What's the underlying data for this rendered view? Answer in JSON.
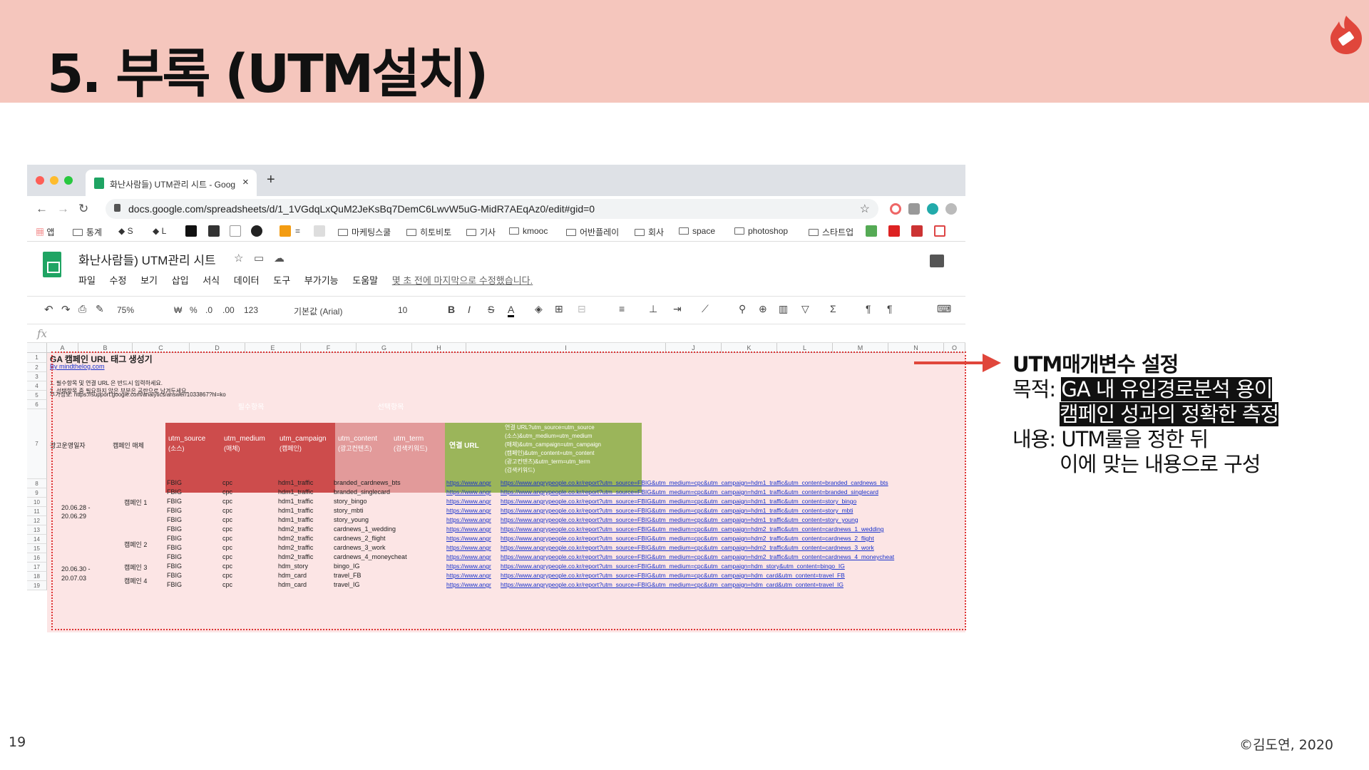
{
  "slide": {
    "title": "5. 부록 (UTM설치)",
    "page_number": "19",
    "copyright": "©김도연, 2020"
  },
  "browser": {
    "tab_title": "화난사람들) UTM관리 시트 - Goog",
    "tab_close": "×",
    "new_tab": "+",
    "url": "docs.google.com/spreadsheets/d/1_1VGdqLxQuM2JeKsBq7DemC6LwvW5uG-MidR7AEqAz0/edit#gid=0",
    "bookmarks": [
      "앱",
      "통계",
      "S",
      "L",
      "=",
      "마케팅스쿨",
      "히토비토",
      "기사",
      "kmooc",
      "어반플레이",
      "회사",
      "space",
      "photoshop",
      "스타트업"
    ]
  },
  "doc": {
    "title": "화난사람들) UTM관리 시트",
    "menus": [
      "파일",
      "수정",
      "보기",
      "삽입",
      "서식",
      "데이터",
      "도구",
      "부가기능",
      "도움말"
    ],
    "last_edit": "몇 초 전에 마지막으로 수정했습니다.",
    "toolbar": {
      "zoom": "75%",
      "currency": "₩",
      "percent": "%",
      "dec_less": ".0",
      "dec_more": ".00",
      "format": "123",
      "font": "기본값 (Arial)",
      "size": "10",
      "bold": "B",
      "italic": "I",
      "strike": "S",
      "color": "A"
    },
    "fx": "fx"
  },
  "sheet": {
    "columns": [
      "A",
      "B",
      "C",
      "D",
      "E",
      "F",
      "G",
      "H",
      "I",
      "J",
      "K",
      "L",
      "M",
      "N",
      "O"
    ],
    "rows": [
      "1",
      "2",
      "3",
      "4",
      "5",
      "6",
      "7",
      "8",
      "9",
      "10",
      "11",
      "12",
      "13",
      "14",
      "15",
      "16",
      "17",
      "18",
      "19"
    ],
    "title": "GA 캠페인 URL 태그 생성기",
    "by": "By mindthelog.com",
    "note1": "1. 필수항목 및 연결 URL 은 반드시 입력하세요.",
    "note2": "2. 선택항목 중 필요하지 않은 부분은 공란으로 남겨두세요.",
    "note3": "추가정보: https://support.google.com/analytics/answer/1033867?hl=ko",
    "group_required": "필수항목",
    "group_optional": "선택항목",
    "h_date": "광고운영일자",
    "h_campaign": "캠페인 매체",
    "h_source": "utm_source",
    "h_source_sub": "(소스)",
    "h_medium": "utm_medium",
    "h_medium_sub": "(매체)",
    "h_campaign_utm": "utm_campaign",
    "h_campaign_sub": "(캠페인)",
    "h_content": "utm_content",
    "h_content_sub": "(광고컨텐츠)",
    "h_term": "utm_term",
    "h_term_sub": "(검색키워드)",
    "h_url": "연결 URL",
    "h_full": [
      "연결 URL?utm_source=utm_source",
      "(소스)&utm_medium=utm_medium",
      "(매체)&utm_campaign=utm_campaign",
      "(캠페인)&utm_content=utm_content",
      "(광고컨텐츠)&utm_term=utm_term",
      "(검색키워드)"
    ],
    "date1": "20.06.28 -",
    "date1b": "20.06.29",
    "date2": "20.06.30 -",
    "date2b": "20.07.03",
    "camp1": "캠페인 1",
    "camp2": "캠페인 2",
    "camp3": "캠페인 3",
    "camp4": "캠페인 4",
    "data": [
      {
        "src": "FBIG",
        "med": "cpc",
        "camp": "hdm1_traffic",
        "content": "branded_cardnews_bts",
        "url": "https://www.angr",
        "full": "https://www.angrypeople.co.kr/report?utm_source=FBIG&utm_medium=cpc&utm_campaign=hdm1_traffic&utm_content=branded_cardnews_bts"
      },
      {
        "src": "FBIG",
        "med": "cpc",
        "camp": "hdm1_traffic",
        "content": "branded_singlecard",
        "url": "https://www.angr",
        "full": "https://www.angrypeople.co.kr/report?utm_source=FBIG&utm_medium=cpc&utm_campaign=hdm1_traffic&utm_content=branded_singlecard"
      },
      {
        "src": "FBIG",
        "med": "cpc",
        "camp": "hdm1_traffic",
        "content": "story_bingo",
        "url": "https://www.angr",
        "full": "https://www.angrypeople.co.kr/report?utm_source=FBIG&utm_medium=cpc&utm_campaign=hdm1_traffic&utm_content=story_bingo"
      },
      {
        "src": "FBIG",
        "med": "cpc",
        "camp": "hdm1_traffic",
        "content": "story_mbti",
        "url": "https://www.angr",
        "full": "https://www.angrypeople.co.kr/report?utm_source=FBIG&utm_medium=cpc&utm_campaign=hdm1_traffic&utm_content=story_mbti"
      },
      {
        "src": "FBIG",
        "med": "cpc",
        "camp": "hdm1_traffic",
        "content": "story_young",
        "url": "https://www.angr",
        "full": "https://www.angrypeople.co.kr/report?utm_source=FBIG&utm_medium=cpc&utm_campaign=hdm1_traffic&utm_content=story_young"
      },
      {
        "src": "FBIG",
        "med": "cpc",
        "camp": "hdm2_traffic",
        "content": "cardnews_1_wedding",
        "url": "https://www.angr",
        "full": "https://www.angrypeople.co.kr/report?utm_source=FBIG&utm_medium=cpc&utm_campaign=hdm2_traffic&utm_content=cardnews_1_wedding"
      },
      {
        "src": "FBIG",
        "med": "cpc",
        "camp": "hdm2_traffic",
        "content": "cardnews_2_flight",
        "url": "https://www.angr",
        "full": "https://www.angrypeople.co.kr/report?utm_source=FBIG&utm_medium=cpc&utm_campaign=hdm2_traffic&utm_content=cardnews_2_flight"
      },
      {
        "src": "FBIG",
        "med": "cpc",
        "camp": "hdm2_traffic",
        "content": "cardnews_3_work",
        "url": "https://www.angr",
        "full": "https://www.angrypeople.co.kr/report?utm_source=FBIG&utm_medium=cpc&utm_campaign=hdm2_traffic&utm_content=cardnews_3_work"
      },
      {
        "src": "FBIG",
        "med": "cpc",
        "camp": "hdm2_traffic",
        "content": "cardnews_4_moneycheat",
        "url": "https://www.angr",
        "full": "https://www.angrypeople.co.kr/report?utm_source=FBIG&utm_medium=cpc&utm_campaign=hdm2_traffic&utm_content=cardnews_4_moneycheat"
      },
      {
        "src": "FBIG",
        "med": "cpc",
        "camp": "hdm_story",
        "content": "bingo_IG",
        "url": "https://www.angr",
        "full": "https://www.angrypeople.co.kr/report?utm_source=FBIG&utm_medium=cpc&utm_campaign=hdm_story&utm_content=bingo_IG"
      },
      {
        "src": "FBIG",
        "med": "cpc",
        "camp": "hdm_card",
        "content": "travel_FB",
        "url": "https://www.angr",
        "full": "https://www.angrypeople.co.kr/report?utm_source=FBIG&utm_medium=cpc&utm_campaign=hdm_card&utm_content=travel_FB"
      },
      {
        "src": "FBIG",
        "med": "cpc",
        "camp": "hdm_card",
        "content": "travel_IG",
        "url": "https://www.angr",
        "full": "https://www.angrypeople.co.kr/report?utm_source=FBIG&utm_medium=cpc&utm_campaign=hdm_card&utm_content=travel_IG"
      }
    ]
  },
  "annotation": {
    "heading": "UTM매개변수 설정",
    "purpose_label": "목적:",
    "purpose_line1": "GA 내 유입경로분석 용이",
    "purpose_line2": "캠페인 성과의 정확한 측정",
    "content_label": "내용:",
    "content_line1": "UTM룰을 정한 뒤",
    "content_line2": "이에 맞는 내용으로 구성"
  },
  "colors": {
    "header_bg": "#f5c6bd",
    "arrow": "#e0463b",
    "required": "#cd4c4c",
    "optional": "#e29a9a",
    "url_col": "#9bb55a"
  }
}
